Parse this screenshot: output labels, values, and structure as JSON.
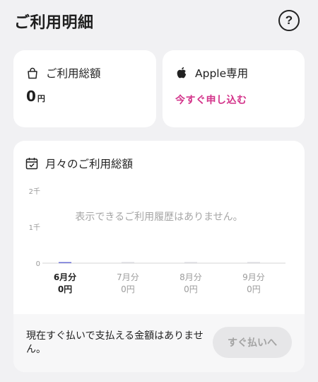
{
  "header": {
    "title": "ご利用明細",
    "help_label": "?"
  },
  "usage_card": {
    "label": "ご利用総額",
    "amount": "0",
    "unit": "円"
  },
  "apple_card": {
    "label": "Apple専用",
    "link": "今すぐ申し込む"
  },
  "monthly": {
    "title": "月々のご利用総額",
    "empty_message": "表示できるご利用履歴はありません。",
    "pay_notice": "現在すぐ払いで支払える金額はありません。",
    "pay_button": "すぐ払いへ"
  },
  "colors": {
    "accent": "#d3338a",
    "bar": "#6b6fd6"
  },
  "icons": {
    "usage": "shopping-bag-icon",
    "apple": "apple-logo-icon",
    "calendar": "calendar-icon",
    "help": "help-icon"
  },
  "chart_data": {
    "type": "bar",
    "categories": [
      "6月分",
      "7月分",
      "8月分",
      "9月分"
    ],
    "values": [
      0,
      0,
      0,
      0
    ],
    "value_labels": [
      "0円",
      "0円",
      "0円",
      "0円"
    ],
    "active_index": 0,
    "ylim": [
      0,
      2000
    ],
    "y_ticks": [
      0,
      1000,
      2000
    ],
    "y_tick_labels": [
      "0",
      "1千",
      "2千"
    ],
    "title": "",
    "xlabel": "",
    "ylabel": ""
  }
}
